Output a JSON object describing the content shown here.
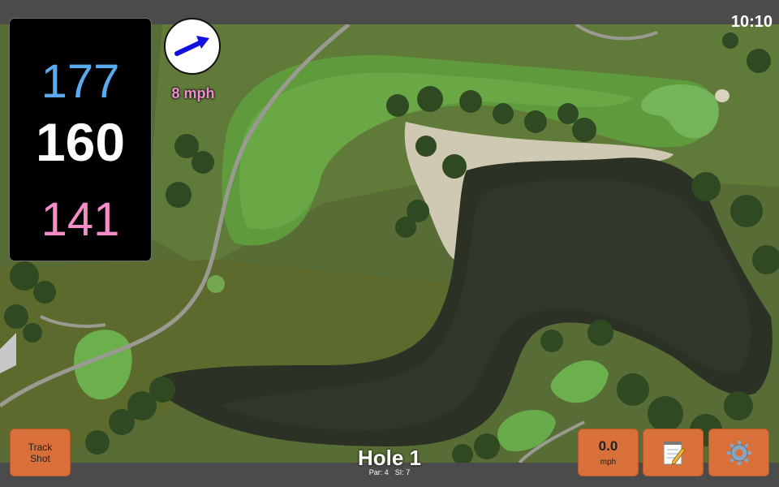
{
  "status_bar": {
    "time": "10:10"
  },
  "yardages": {
    "back": "177",
    "middle": "160",
    "front": "141"
  },
  "wind": {
    "speed_label": "8 mph",
    "arrow_color": "#1010e0"
  },
  "buttons": {
    "track_shot_line1": "Track",
    "track_shot_line2": "Shot",
    "speed_value": "0.0",
    "speed_unit": "mph",
    "notes_icon": "notepad-icon",
    "settings_icon": "gear-icon"
  },
  "hole": {
    "title": "Hole 1",
    "par": "Par: 4",
    "si": "SI: 7"
  },
  "colors": {
    "button": "#d9703a",
    "back_yardage": "#5aaaf0",
    "front_yardage": "#f58cc8",
    "wind_text": "#f08ccf"
  }
}
